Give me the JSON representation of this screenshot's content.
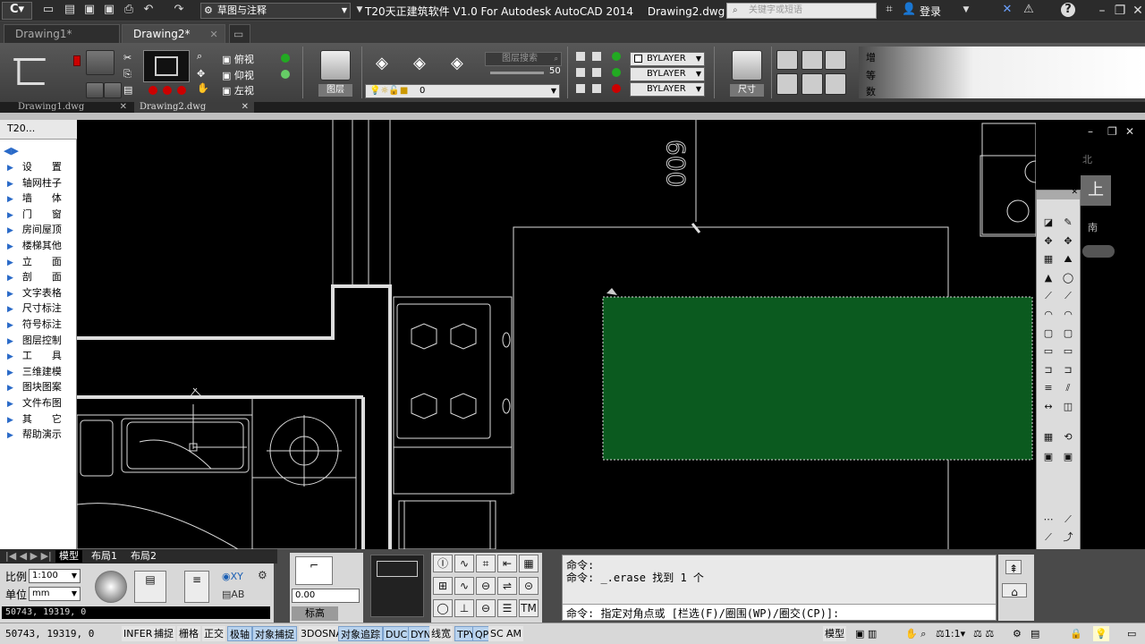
{
  "titlebar": {
    "workspace": "草图与注释",
    "app_title": "T20天正建筑软件 V1.0 For Autodesk AutoCAD 2014",
    "drawing_title": "Drawing2.dwg",
    "search_placeholder": "关键字或短语",
    "login": "登录",
    "help_icon": "help-icon"
  },
  "document_tabs": [
    {
      "label": "Drawing1*",
      "active": false
    },
    {
      "label": "Drawing2*",
      "active": true
    }
  ],
  "ribbon": {
    "view_labels": [
      "俯视",
      "仰视",
      "左视"
    ],
    "layer_button": "图层",
    "layer_search_placeholder": "图层搜索",
    "layer_slider_value": "50",
    "layer_current": "0",
    "bylayer_color": "BYLAYER",
    "bylayer_linetype": "BYLAYER",
    "bylayer_lineweight": "BYLAYER",
    "dimension_button": "尺寸",
    "right_labels": [
      "增",
      "等",
      "数"
    ]
  },
  "file_tabs": [
    {
      "label": "Drawing1.dwg",
      "active": false
    },
    {
      "label": "Drawing2.dwg",
      "active": true
    }
  ],
  "palette": {
    "title": "T20...",
    "items": [
      "设　　置",
      "轴网柱子",
      "墙　　体",
      "门　　窗",
      "房间屋顶",
      "楼梯其他",
      "立　　面",
      "剖　　面",
      "文字表格",
      "尺寸标注",
      "符号标注",
      "图层控制",
      "工　　具",
      "三维建模",
      "图块图案",
      "文件布图",
      "其　　它",
      "帮助演示"
    ]
  },
  "canvas": {
    "dimension_text": "600",
    "viewcube_top": "上",
    "viewcube_north": "北",
    "viewcube_south": "南",
    "selection_color": "#0b5a1f"
  },
  "layout_tabs": [
    {
      "label": "模型",
      "active": true
    },
    {
      "label": "布局1",
      "active": false
    },
    {
      "label": "布局2",
      "active": false
    }
  ],
  "bottom": {
    "scale_label": "比例",
    "scale_value": "1:100",
    "unit_label": "单位",
    "unit_value": "mm",
    "coord_readout": "50743, 19319, 0",
    "elevation_value": "0.00",
    "elevation_label": "标高"
  },
  "command": {
    "lines": [
      "命令:",
      "命令: _.erase 找到 1 个"
    ],
    "prompt": "命令: 指定对角点或 [栏选(F)/圈围(WP)/圈交(CP)]:"
  },
  "statusbar": {
    "coords": "50743, 19319, 0",
    "toggles": [
      {
        "label": "INFER",
        "on": false
      },
      {
        "label": "捕捉",
        "on": false
      },
      {
        "label": "栅格",
        "on": false
      },
      {
        "label": "正交",
        "on": false
      },
      {
        "label": "极轴",
        "on": true
      },
      {
        "label": "对象捕捉",
        "on": true
      },
      {
        "label": "3DOSNAP",
        "on": false
      },
      {
        "label": "对象追踪",
        "on": true
      },
      {
        "label": "DUCS",
        "on": true
      },
      {
        "label": "DYN",
        "on": true
      },
      {
        "label": "线宽",
        "on": false
      },
      {
        "label": "TPY",
        "on": true
      },
      {
        "label": "QP",
        "on": true
      },
      {
        "label": "SC",
        "on": false
      },
      {
        "label": "AM",
        "on": false
      }
    ],
    "model_label": "模型",
    "annotation_scale": "1:1"
  }
}
